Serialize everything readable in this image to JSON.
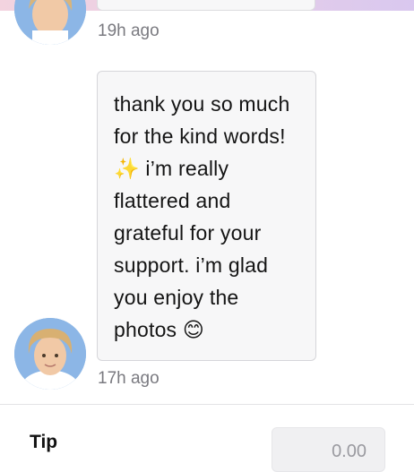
{
  "chat": {
    "previous_message": {
      "timestamp": "19h ago"
    },
    "message": {
      "text": "thank you so much for the kind words! ✨ i’m really flattered and grateful for your support. i’m glad you enjoy the photos 😊",
      "timestamp": "17h ago"
    }
  },
  "tip": {
    "label": "Tip",
    "value": "0.00"
  },
  "colors": {
    "top_gradient_start": "#f3d3df",
    "top_gradient_end": "#d9c8ef",
    "bubble_bg": "#f7f7f8",
    "timestamp": "#7a7a80"
  }
}
